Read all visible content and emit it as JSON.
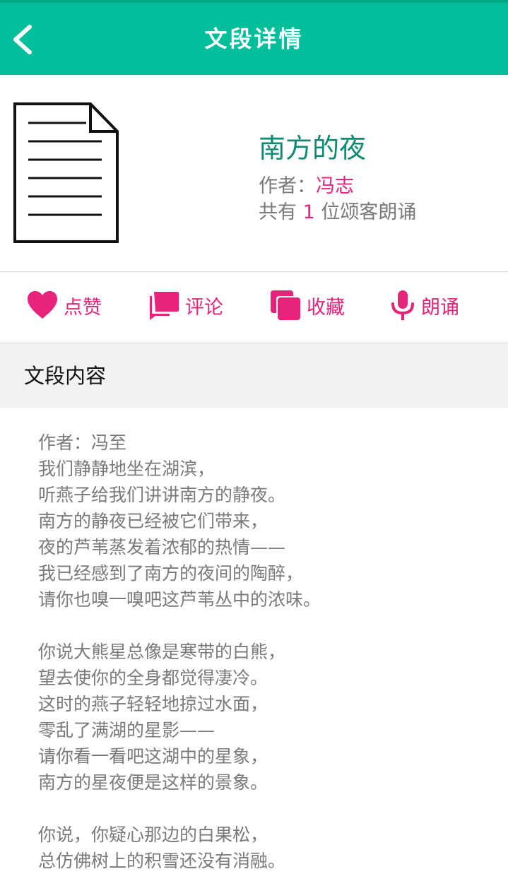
{
  "header": {
    "title": "文段详情",
    "background": "#00bf9a"
  },
  "article": {
    "title": "南方的夜",
    "author_prefix": "作者：",
    "author": "冯志",
    "count_prefix": "共有",
    "count": "1",
    "count_suffix": "位颂客朗诵",
    "icon": "document-icon"
  },
  "actions": [
    {
      "label": "点赞",
      "icon": "heart-icon"
    },
    {
      "label": "评论",
      "icon": "comment-icon"
    },
    {
      "label": "收藏",
      "icon": "collection-icon"
    },
    {
      "label": "朗诵",
      "icon": "microphone-icon"
    }
  ],
  "section": {
    "title": "文段内容"
  },
  "content": {
    "lines": [
      "作者：冯至",
      "我们静静地坐在湖滨，",
      "听燕子给我们讲讲南方的静夜。",
      "南方的静夜已经被它们带来，",
      "夜的芦苇蒸发着浓郁的热情——",
      "我已经感到了南方的夜间的陶醉，",
      "请你也嗅一嗅吧这芦苇丛中的浓味。",
      "",
      "你说大熊星总像是寒带的白熊，",
      "望去使你的全身都觉得凄冷。",
      "这时的燕子轻轻地掠过水面，",
      "零乱了满湖的星影——",
      "请你看一看吧这湖中的星象，",
      "南方的星夜便是这样的景象。",
      "",
      "你说，你疑心那边的白果松，",
      "总仿佛树上的积雪还没有消融。"
    ]
  },
  "colors": {
    "accent": "#e8237a",
    "title": "#0f8a72",
    "muted_text": "#7a7a7a"
  }
}
